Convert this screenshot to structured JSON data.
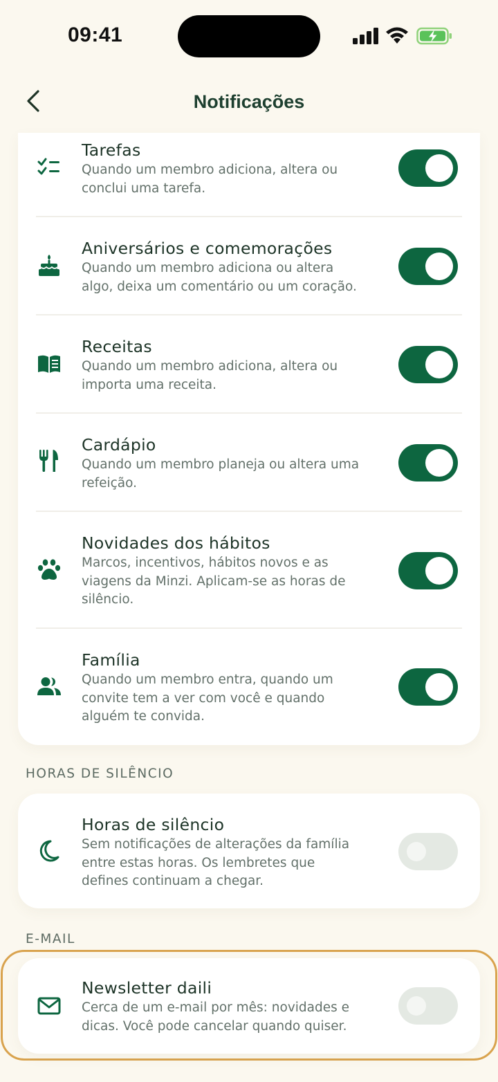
{
  "status_bar": {
    "time": "09:41"
  },
  "header": {
    "title": "Notificações"
  },
  "notifications": [
    {
      "icon": "checklist-icon",
      "title": "Tarefas",
      "desc": "Quando um membro adiciona, altera ou\nconclui uma tarefa.",
      "enabled": true
    },
    {
      "icon": "cake-icon",
      "title": "Aniversários e comemorações",
      "desc": "Quando um membro adiciona ou altera\nalgo, deixa um comentário ou um coração.",
      "enabled": true
    },
    {
      "icon": "book-icon",
      "title": "Receitas",
      "desc": "Quando um membro adiciona, altera ou\nimporta uma receita.",
      "enabled": true
    },
    {
      "icon": "fork-knife-icon",
      "title": "Cardápio",
      "desc": "Quando um membro planeja ou altera uma\nrefeição.",
      "enabled": true
    },
    {
      "icon": "paw-icon",
      "title": "Novidades dos hábitos",
      "desc": "Marcos, incentivos, hábitos novos e as\nviagens da Minzi. Aplicam-se as horas de\nsilêncio.",
      "enabled": true
    },
    {
      "icon": "people-icon",
      "title": "Família",
      "desc": "Quando um membro entra, quando um\nconvite tem a ver com você e quando\nalguém te convida.",
      "enabled": true
    }
  ],
  "quiet_hours": {
    "section_label": "HORAS DE SILÊNCIO",
    "icon": "moon-icon",
    "title": "Horas de silêncio",
    "desc": "Sem notificações de alterações da família\nentre estas horas. Os lembretes que\ndefines continuam a chegar.",
    "enabled": false
  },
  "email": {
    "section_label": "E-MAIL",
    "icon": "mail-icon",
    "title": "Newsletter daili",
    "desc": "Cerca de um e-mail por mês: novidades e\ndicas. Você pode cancelar quando quiser.",
    "enabled": false
  },
  "colors": {
    "accent": "#0d6640",
    "toggle_off": "#e4e9e3",
    "background": "#fbf8ef",
    "highlight": "#d9a34e"
  }
}
